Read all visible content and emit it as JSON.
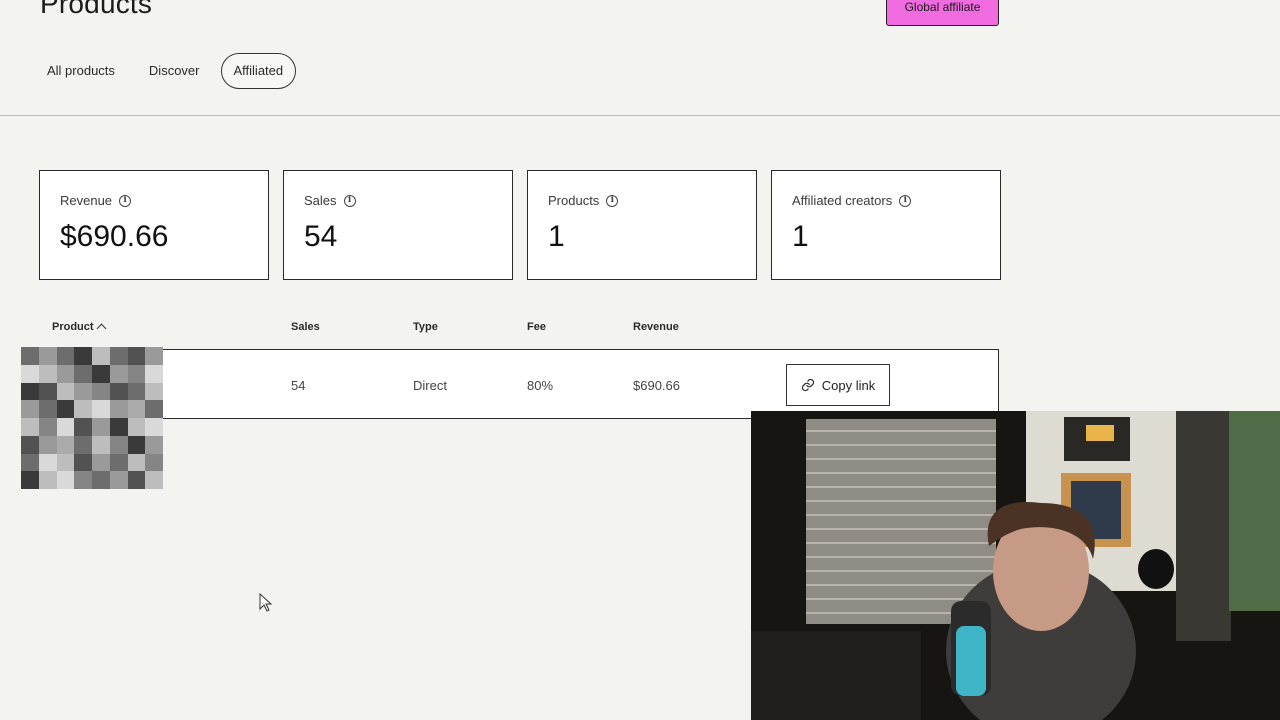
{
  "header": {
    "title": "Products",
    "global_affiliate_label": "Global affiliate",
    "global_affiliate_color": "#f06bdf"
  },
  "tabs": [
    {
      "label": "All products",
      "active": false
    },
    {
      "label": "Discover",
      "active": false
    },
    {
      "label": "Affiliated",
      "active": true
    }
  ],
  "stats": [
    {
      "label": "Revenue",
      "value": "$690.66",
      "icon": "info-icon"
    },
    {
      "label": "Sales",
      "value": "54",
      "icon": "info-icon"
    },
    {
      "label": "Products",
      "value": "1",
      "icon": "info-icon"
    },
    {
      "label": "Affiliated creators",
      "value": "1",
      "icon": "info-icon"
    }
  ],
  "table": {
    "columns": [
      "Product",
      "Sales",
      "Type",
      "Fee",
      "Revenue"
    ],
    "sort_icon": "chevron-up-icon",
    "rows": [
      {
        "product_thumbnail": "pixelated-thumbnail",
        "sales": "54",
        "type": "Direct",
        "fee": "80%",
        "revenue": "$690.66",
        "action_label": "Copy link",
        "action_icon": "link-icon"
      }
    ]
  },
  "overlay": {
    "webcam": "webcam-feed"
  }
}
